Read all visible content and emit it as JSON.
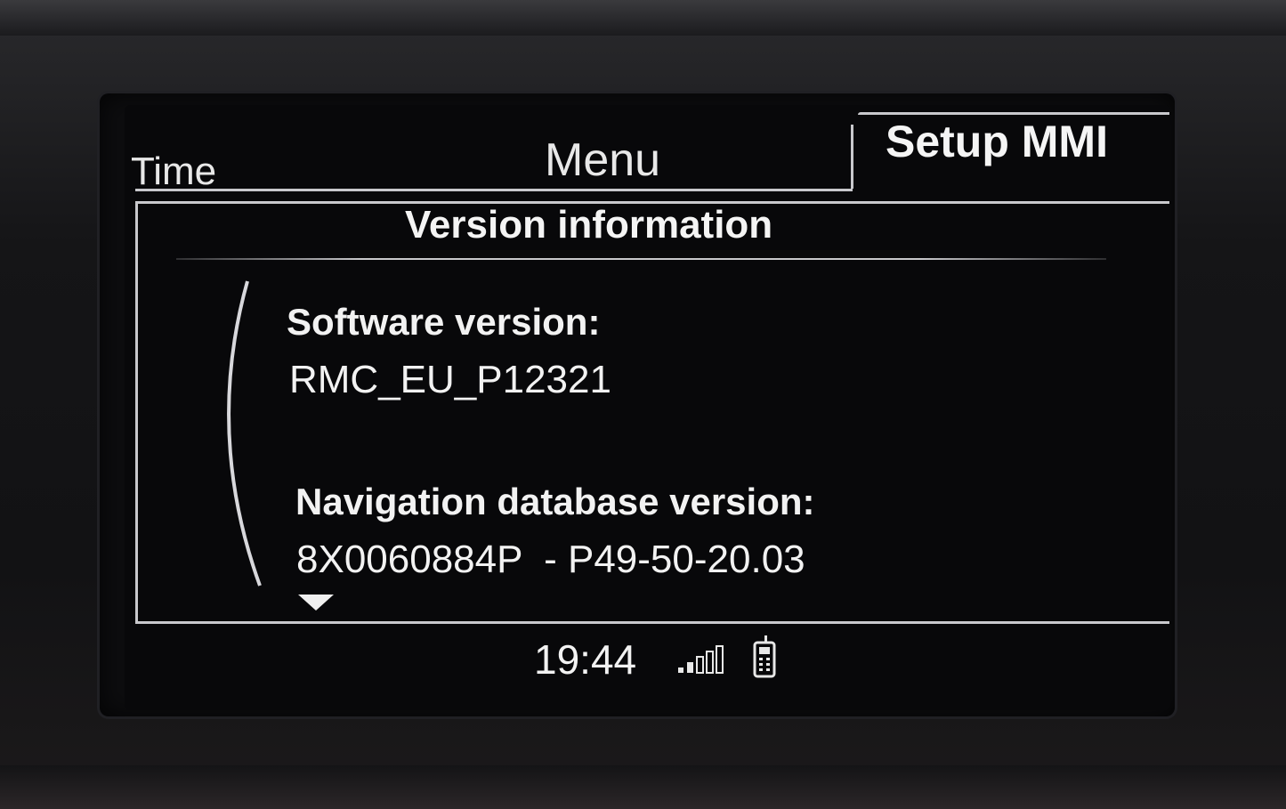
{
  "tabs": {
    "time": "Time",
    "menu": "Menu",
    "setup": "Setup MMI"
  },
  "panel": {
    "title": "Version information",
    "software_label": "Software version:",
    "software_value": "RMC_EU_P12321",
    "nav_label": "Navigation database version:",
    "nav_value": "8X0060884P  - P49-50-20.03"
  },
  "status": {
    "time": "19:44",
    "signal_icon": "signal-strength-icon",
    "phone_icon": "phone-icon"
  },
  "colors": {
    "text": "#f2f2f2",
    "frame": "#c8c8cc",
    "background": "#08080a"
  }
}
